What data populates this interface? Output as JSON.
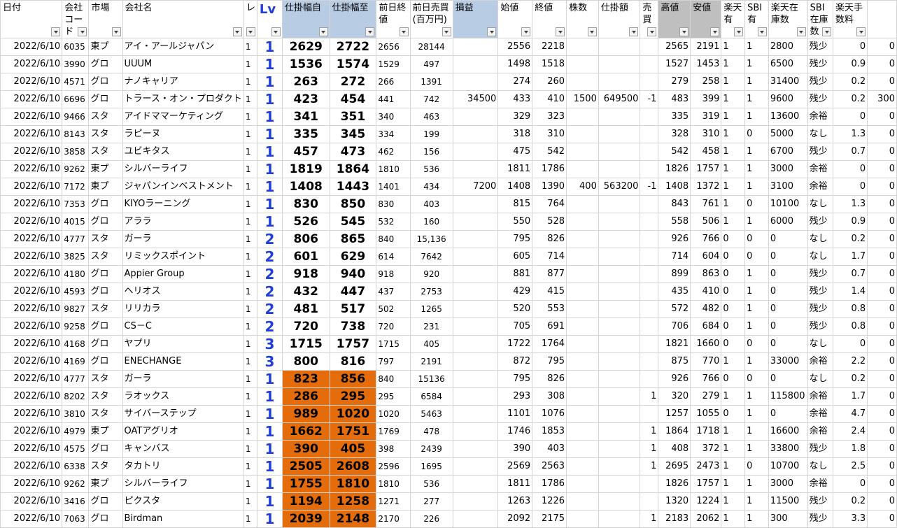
{
  "headers": [
    {
      "label": "日付",
      "style": ""
    },
    {
      "label": "会社コード",
      "style": ""
    },
    {
      "label": "市場",
      "style": ""
    },
    {
      "label": "会社名",
      "style": ""
    },
    {
      "label": "レ",
      "style": ""
    },
    {
      "label": "Lv",
      "style": "hlv"
    },
    {
      "label": "仕掛幅自",
      "style": "hblue"
    },
    {
      "label": "仕掛幅至",
      "style": "hblue"
    },
    {
      "label": "前日終値",
      "style": ""
    },
    {
      "label": "前日売買(百万円)",
      "style": ""
    },
    {
      "label": "損益",
      "style": "hblue"
    },
    {
      "label": "始値",
      "style": ""
    },
    {
      "label": "終値",
      "style": ""
    },
    {
      "label": "株数",
      "style": ""
    },
    {
      "label": "仕掛額",
      "style": ""
    },
    {
      "label": "売買",
      "style": ""
    },
    {
      "label": "高値",
      "style": "hgray"
    },
    {
      "label": "安値",
      "style": "hgray"
    },
    {
      "label": "楽天有",
      "style": ""
    },
    {
      "label": "SBI有",
      "style": ""
    },
    {
      "label": "楽天在庫数",
      "style": ""
    },
    {
      "label": "SBI在庫数",
      "style": ""
    },
    {
      "label": "楽天手数料",
      "style": ""
    },
    {
      "label": "",
      "style": ""
    }
  ],
  "rows": [
    {
      "date": "2022/6/10",
      "code": "6035",
      "market": "東プ",
      "name": "アイ・アールジャパン",
      "re": "1",
      "lv": "1",
      "from": "2629",
      "to": "2722",
      "prev_close": "2656",
      "prev_vol": "28144",
      "pnl": "",
      "open": "2556",
      "close": "2218",
      "shares": "",
      "amount": "",
      "side": "",
      "high": "2565",
      "low": "2191",
      "rk_has": "1",
      "sbi_has": "1",
      "rk_stock": "2800",
      "sbi_stock": "残少",
      "rk_fee": "0",
      "extra": "0",
      "orange": false
    },
    {
      "date": "2022/6/10",
      "code": "3990",
      "market": "グロ",
      "name": "UUUM",
      "re": "1",
      "lv": "1",
      "from": "1536",
      "to": "1574",
      "prev_close": "1529",
      "prev_vol": "497",
      "pnl": "",
      "open": "1498",
      "close": "1518",
      "shares": "",
      "amount": "",
      "side": "",
      "high": "1527",
      "low": "1453",
      "rk_has": "1",
      "sbi_has": "1",
      "rk_stock": "6500",
      "sbi_stock": "残少",
      "rk_fee": "0.9",
      "extra": "0",
      "orange": false
    },
    {
      "date": "2022/6/10",
      "code": "4571",
      "market": "グロ",
      "name": "ナノキャリア",
      "re": "1",
      "lv": "1",
      "from": "263",
      "to": "272",
      "prev_close": "266",
      "prev_vol": "1391",
      "pnl": "",
      "open": "274",
      "close": "260",
      "shares": "",
      "amount": "",
      "side": "",
      "high": "279",
      "low": "258",
      "rk_has": "1",
      "sbi_has": "1",
      "rk_stock": "31400",
      "sbi_stock": "残少",
      "rk_fee": "0.2",
      "extra": "0",
      "orange": false
    },
    {
      "date": "2022/6/10",
      "code": "6696",
      "market": "グロ",
      "name": "トラース・オン・プロダクト",
      "re": "1",
      "lv": "1",
      "from": "423",
      "to": "454",
      "prev_close": "441",
      "prev_vol": "742",
      "pnl": "34500",
      "open": "433",
      "close": "410",
      "shares": "1500",
      "amount": "649500",
      "side": "-1",
      "high": "483",
      "low": "399",
      "rk_has": "1",
      "sbi_has": "1",
      "rk_stock": "9600",
      "sbi_stock": "残少",
      "rk_fee": "0.2",
      "extra": "300",
      "orange": false
    },
    {
      "date": "2022/6/10",
      "code": "9466",
      "market": "スタ",
      "name": "アイドママーケティング",
      "re": "1",
      "lv": "1",
      "from": "341",
      "to": "351",
      "prev_close": "340",
      "prev_vol": "463",
      "pnl": "",
      "open": "329",
      "close": "323",
      "shares": "",
      "amount": "",
      "side": "",
      "high": "335",
      "low": "319",
      "rk_has": "1",
      "sbi_has": "1",
      "rk_stock": "13600",
      "sbi_stock": "余裕",
      "rk_fee": "0",
      "extra": "0",
      "orange": false
    },
    {
      "date": "2022/6/10",
      "code": "8143",
      "market": "スタ",
      "name": "ラピーヌ",
      "re": "1",
      "lv": "1",
      "from": "335",
      "to": "345",
      "prev_close": "334",
      "prev_vol": "199",
      "pnl": "",
      "open": "318",
      "close": "310",
      "shares": "",
      "amount": "",
      "side": "",
      "high": "328",
      "low": "310",
      "rk_has": "1",
      "sbi_has": "0",
      "rk_stock": "5000",
      "sbi_stock": "なし",
      "rk_fee": "1.3",
      "extra": "0",
      "orange": false
    },
    {
      "date": "2022/6/10",
      "code": "3858",
      "market": "スタ",
      "name": "ユビキタス",
      "re": "1",
      "lv": "1",
      "from": "457",
      "to": "473",
      "prev_close": "462",
      "prev_vol": "156",
      "pnl": "",
      "open": "475",
      "close": "542",
      "shares": "",
      "amount": "",
      "side": "",
      "high": "542",
      "low": "458",
      "rk_has": "1",
      "sbi_has": "1",
      "rk_stock": "6700",
      "sbi_stock": "残少",
      "rk_fee": "0.7",
      "extra": "0",
      "orange": false
    },
    {
      "date": "2022/6/10",
      "code": "9262",
      "market": "東プ",
      "name": "シルバーライフ",
      "re": "1",
      "lv": "1",
      "from": "1819",
      "to": "1864",
      "prev_close": "1810",
      "prev_vol": "536",
      "pnl": "",
      "open": "1811",
      "close": "1786",
      "shares": "",
      "amount": "",
      "side": "",
      "high": "1826",
      "low": "1757",
      "rk_has": "1",
      "sbi_has": "1",
      "rk_stock": "3000",
      "sbi_stock": "余裕",
      "rk_fee": "0",
      "extra": "0",
      "orange": false
    },
    {
      "date": "2022/6/10",
      "code": "7172",
      "market": "東プ",
      "name": "ジャパンインベストメント",
      "re": "1",
      "lv": "1",
      "from": "1408",
      "to": "1443",
      "prev_close": "1401",
      "prev_vol": "434",
      "pnl": "7200",
      "open": "1408",
      "close": "1390",
      "shares": "400",
      "amount": "563200",
      "side": "-1",
      "high": "1408",
      "low": "1372",
      "rk_has": "1",
      "sbi_has": "1",
      "rk_stock": "3100",
      "sbi_stock": "余裕",
      "rk_fee": "0",
      "extra": "0",
      "orange": false
    },
    {
      "date": "2022/6/10",
      "code": "7353",
      "market": "グロ",
      "name": "KIYOラーニング",
      "re": "1",
      "lv": "1",
      "from": "830",
      "to": "850",
      "prev_close": "830",
      "prev_vol": "403",
      "pnl": "",
      "open": "815",
      "close": "764",
      "shares": "",
      "amount": "",
      "side": "",
      "high": "843",
      "low": "761",
      "rk_has": "1",
      "sbi_has": "0",
      "rk_stock": "10100",
      "sbi_stock": "なし",
      "rk_fee": "1.3",
      "extra": "0",
      "orange": false
    },
    {
      "date": "2022/6/10",
      "code": "4015",
      "market": "グロ",
      "name": "アララ",
      "re": "1",
      "lv": "1",
      "from": "526",
      "to": "545",
      "prev_close": "532",
      "prev_vol": "160",
      "pnl": "",
      "open": "550",
      "close": "528",
      "shares": "",
      "amount": "",
      "side": "",
      "high": "558",
      "low": "506",
      "rk_has": "1",
      "sbi_has": "1",
      "rk_stock": "6000",
      "sbi_stock": "残少",
      "rk_fee": "0.9",
      "extra": "0",
      "orange": false
    },
    {
      "date": "2022/6/10",
      "code": "4777",
      "market": "スタ",
      "name": "ガーラ",
      "re": "1",
      "lv": "2",
      "from": "806",
      "to": "865",
      "prev_close": "840",
      "prev_vol": "15,136",
      "pnl": "",
      "open": "795",
      "close": "826",
      "shares": "",
      "amount": "",
      "side": "",
      "high": "926",
      "low": "766",
      "rk_has": "0",
      "sbi_has": "0",
      "rk_stock": "0",
      "sbi_stock": "なし",
      "rk_fee": "0.2",
      "extra": "0",
      "orange": false
    },
    {
      "date": "2022/6/10",
      "code": "3825",
      "market": "スタ",
      "name": "リミックスポイント",
      "re": "1",
      "lv": "2",
      "from": "601",
      "to": "629",
      "prev_close": "614",
      "prev_vol": "7642",
      "pnl": "",
      "open": "605",
      "close": "714",
      "shares": "",
      "amount": "",
      "side": "",
      "high": "714",
      "low": "604",
      "rk_has": "0",
      "sbi_has": "0",
      "rk_stock": "0",
      "sbi_stock": "なし",
      "rk_fee": "1.7",
      "extra": "0",
      "orange": false
    },
    {
      "date": "2022/6/10",
      "code": "4180",
      "market": "グロ",
      "name": "Appier Group",
      "re": "1",
      "lv": "2",
      "from": "918",
      "to": "940",
      "prev_close": "918",
      "prev_vol": "920",
      "pnl": "",
      "open": "881",
      "close": "877",
      "shares": "",
      "amount": "",
      "side": "",
      "high": "899",
      "low": "863",
      "rk_has": "0",
      "sbi_has": "1",
      "rk_stock": "0",
      "sbi_stock": "残少",
      "rk_fee": "0.7",
      "extra": "0",
      "orange": false
    },
    {
      "date": "2022/6/10",
      "code": "4593",
      "market": "グロ",
      "name": "ヘリオス",
      "re": "1",
      "lv": "2",
      "from": "432",
      "to": "447",
      "prev_close": "437",
      "prev_vol": "2753",
      "pnl": "",
      "open": "429",
      "close": "415",
      "shares": "",
      "amount": "",
      "side": "",
      "high": "435",
      "low": "410",
      "rk_has": "0",
      "sbi_has": "1",
      "rk_stock": "0",
      "sbi_stock": "残少",
      "rk_fee": "1.4",
      "extra": "0",
      "orange": false
    },
    {
      "date": "2022/6/10",
      "code": "9827",
      "market": "スタ",
      "name": "リリカラ",
      "re": "1",
      "lv": "2",
      "from": "481",
      "to": "517",
      "prev_close": "502",
      "prev_vol": "1265",
      "pnl": "",
      "open": "520",
      "close": "553",
      "shares": "",
      "amount": "",
      "side": "",
      "high": "572",
      "low": "482",
      "rk_has": "0",
      "sbi_has": "1",
      "rk_stock": "0",
      "sbi_stock": "残少",
      "rk_fee": "0.8",
      "extra": "0",
      "orange": false
    },
    {
      "date": "2022/6/10",
      "code": "9258",
      "market": "グロ",
      "name": "CS－C",
      "re": "1",
      "lv": "2",
      "from": "720",
      "to": "738",
      "prev_close": "720",
      "prev_vol": "231",
      "pnl": "",
      "open": "705",
      "close": "691",
      "shares": "",
      "amount": "",
      "side": "",
      "high": "706",
      "low": "684",
      "rk_has": "0",
      "sbi_has": "1",
      "rk_stock": "0",
      "sbi_stock": "残少",
      "rk_fee": "0.8",
      "extra": "0",
      "orange": false
    },
    {
      "date": "2022/6/10",
      "code": "4168",
      "market": "グロ",
      "name": "ヤプリ",
      "re": "1",
      "lv": "3",
      "from": "1715",
      "to": "1757",
      "prev_close": "1715",
      "prev_vol": "405",
      "pnl": "",
      "open": "1722",
      "close": "1764",
      "shares": "",
      "amount": "",
      "side": "",
      "high": "1821",
      "low": "1660",
      "rk_has": "0",
      "sbi_has": "0",
      "rk_stock": "0",
      "sbi_stock": "なし",
      "rk_fee": "0",
      "extra": "0",
      "orange": false
    },
    {
      "date": "2022/6/10",
      "code": "4169",
      "market": "グロ",
      "name": "ENECHANGE",
      "re": "1",
      "lv": "3",
      "from": "800",
      "to": "816",
      "prev_close": "797",
      "prev_vol": "2191",
      "pnl": "",
      "open": "872",
      "close": "795",
      "shares": "",
      "amount": "",
      "side": "",
      "high": "875",
      "low": "770",
      "rk_has": "1",
      "sbi_has": "1",
      "rk_stock": "33000",
      "sbi_stock": "余裕",
      "rk_fee": "2.2",
      "extra": "0",
      "orange": false
    },
    {
      "date": "2022/6/10",
      "code": "4777",
      "market": "スタ",
      "name": "ガーラ",
      "re": "1",
      "lv": "1",
      "from": "823",
      "to": "856",
      "prev_close": "840",
      "prev_vol": "15136",
      "pnl": "",
      "open": "795",
      "close": "826",
      "shares": "",
      "amount": "",
      "side": "",
      "high": "926",
      "low": "766",
      "rk_has": "0",
      "sbi_has": "0",
      "rk_stock": "0",
      "sbi_stock": "なし",
      "rk_fee": "0.2",
      "extra": "0",
      "orange": true
    },
    {
      "date": "2022/6/10",
      "code": "8202",
      "market": "スタ",
      "name": "ラオックス",
      "re": "1",
      "lv": "1",
      "from": "286",
      "to": "295",
      "prev_close": "295",
      "prev_vol": "6584",
      "pnl": "",
      "open": "293",
      "close": "308",
      "shares": "",
      "amount": "",
      "side": "1",
      "high": "320",
      "low": "279",
      "rk_has": "1",
      "sbi_has": "1",
      "rk_stock": "115800",
      "sbi_stock": "余裕",
      "rk_fee": "1.7",
      "extra": "0",
      "orange": true
    },
    {
      "date": "2022/6/10",
      "code": "3810",
      "market": "スタ",
      "name": "サイバーステップ",
      "re": "1",
      "lv": "1",
      "from": "989",
      "to": "1020",
      "prev_close": "1020",
      "prev_vol": "5463",
      "pnl": "",
      "open": "1101",
      "close": "1076",
      "shares": "",
      "amount": "",
      "side": "",
      "high": "1257",
      "low": "1055",
      "rk_has": "0",
      "sbi_has": "1",
      "rk_stock": "0",
      "sbi_stock": "余裕",
      "rk_fee": "4.7",
      "extra": "0",
      "orange": true
    },
    {
      "date": "2022/6/10",
      "code": "4979",
      "market": "東プ",
      "name": "OATアグリオ",
      "re": "1",
      "lv": "1",
      "from": "1662",
      "to": "1751",
      "prev_close": "1769",
      "prev_vol": "478",
      "pnl": "",
      "open": "1746",
      "close": "1853",
      "shares": "",
      "amount": "",
      "side": "1",
      "high": "1864",
      "low": "1718",
      "rk_has": "1",
      "sbi_has": "1",
      "rk_stock": "16600",
      "sbi_stock": "余裕",
      "rk_fee": "2.4",
      "extra": "0",
      "orange": true
    },
    {
      "date": "2022/6/10",
      "code": "4575",
      "market": "グロ",
      "name": "キャンバス",
      "re": "1",
      "lv": "1",
      "from": "390",
      "to": "405",
      "prev_close": "398",
      "prev_vol": "2439",
      "pnl": "",
      "open": "390",
      "close": "403",
      "shares": "",
      "amount": "",
      "side": "1",
      "high": "408",
      "low": "372",
      "rk_has": "1",
      "sbi_has": "1",
      "rk_stock": "33800",
      "sbi_stock": "残少",
      "rk_fee": "1.8",
      "extra": "0",
      "orange": true
    },
    {
      "date": "2022/6/10",
      "code": "6338",
      "market": "スタ",
      "name": "タカトリ",
      "re": "1",
      "lv": "1",
      "from": "2505",
      "to": "2608",
      "prev_close": "2596",
      "prev_vol": "1695",
      "pnl": "",
      "open": "2569",
      "close": "2563",
      "shares": "",
      "amount": "",
      "side": "1",
      "high": "2695",
      "low": "2473",
      "rk_has": "1",
      "sbi_has": "0",
      "rk_stock": "10700",
      "sbi_stock": "なし",
      "rk_fee": "2.5",
      "extra": "0",
      "orange": true
    },
    {
      "date": "2022/6/10",
      "code": "9262",
      "market": "東プ",
      "name": "シルバーライフ",
      "re": "1",
      "lv": "1",
      "from": "1755",
      "to": "1810",
      "prev_close": "1810",
      "prev_vol": "536",
      "pnl": "",
      "open": "1811",
      "close": "1786",
      "shares": "",
      "amount": "",
      "side": "",
      "high": "1826",
      "low": "1757",
      "rk_has": "1",
      "sbi_has": "1",
      "rk_stock": "3000",
      "sbi_stock": "余裕",
      "rk_fee": "0",
      "extra": "0",
      "orange": true
    },
    {
      "date": "2022/6/10",
      "code": "3416",
      "market": "グロ",
      "name": "ピクスタ",
      "re": "1",
      "lv": "1",
      "from": "1194",
      "to": "1258",
      "prev_close": "1271",
      "prev_vol": "277",
      "pnl": "",
      "open": "1263",
      "close": "1226",
      "shares": "",
      "amount": "",
      "side": "",
      "high": "1320",
      "low": "1224",
      "rk_has": "1",
      "sbi_has": "1",
      "rk_stock": "11500",
      "sbi_stock": "残少",
      "rk_fee": "0.2",
      "extra": "0",
      "orange": true
    },
    {
      "date": "2022/6/10",
      "code": "7063",
      "market": "グロ",
      "name": "Birdman",
      "re": "1",
      "lv": "1",
      "from": "2039",
      "to": "2148",
      "prev_close": "2170",
      "prev_vol": "226",
      "pnl": "",
      "open": "2092",
      "close": "2175",
      "shares": "",
      "amount": "",
      "side": "1",
      "high": "2183",
      "low": "2062",
      "rk_has": "1",
      "sbi_has": "1",
      "rk_stock": "300",
      "sbi_stock": "残少",
      "rk_fee": "3.3",
      "extra": "0",
      "orange": true
    }
  ]
}
